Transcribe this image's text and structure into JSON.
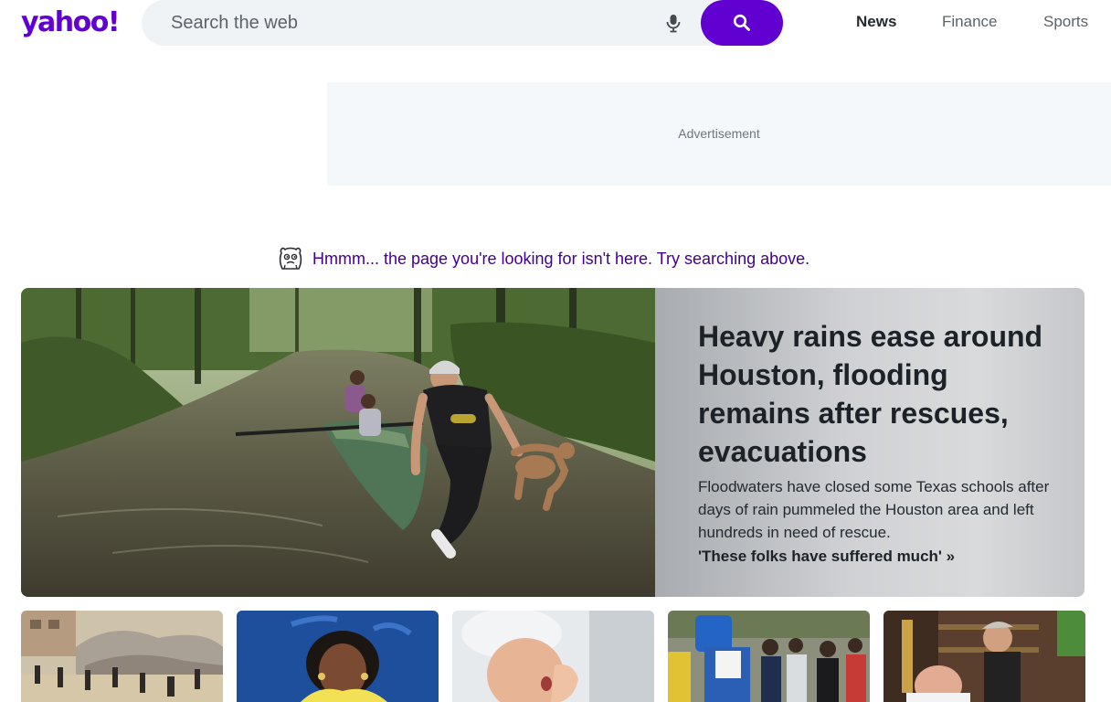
{
  "header": {
    "logo_text": "yahoo!",
    "search": {
      "placeholder": "Search the web",
      "mic_icon": "microphone-icon",
      "search_icon": "magnifier-icon"
    },
    "nav": [
      {
        "label": "News",
        "active": true
      },
      {
        "label": "Finance",
        "active": false
      },
      {
        "label": "Sports",
        "active": false
      }
    ]
  },
  "advertisement": {
    "label": "Advertisement"
  },
  "notice": {
    "icon": "confused-creature-icon",
    "text": "Hmmm... the page you're looking for isn't here. Try searching above."
  },
  "hero": {
    "title": "Heavy rains ease around Houston, flooding remains after rescues, evacuations",
    "summary": "Floodwaters have closed some Texas schools after days of rain pummeled the Houston area and left hundreds in need of rescue.",
    "link": "'These folks have suffered much' »"
  },
  "thumbnails": [
    {
      "subject": "ruins"
    },
    {
      "subject": "portrait"
    },
    {
      "subject": "sneeze"
    },
    {
      "subject": "protest"
    },
    {
      "subject": "barber"
    }
  ],
  "colors": {
    "brand": "#6001d2",
    "notice_text": "#400090"
  }
}
